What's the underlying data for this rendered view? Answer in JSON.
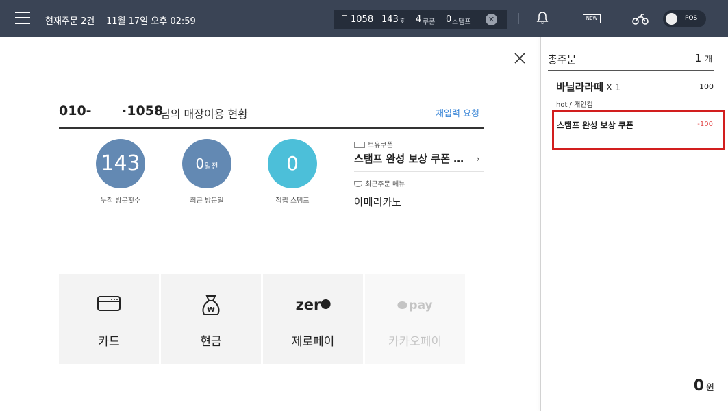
{
  "topbar": {
    "order_status": "현재주문 2건",
    "datetime": "11월 17일 오후 02:59",
    "customer_phone_last4": "1058",
    "visit_count": "143",
    "visit_unit": "회",
    "coupon_count": "4",
    "coupon_unit": "쿠폰",
    "stamp_count": "0",
    "stamp_unit": "스탬프",
    "new_badge": "NEW",
    "pos_toggle_label": "POS",
    "icons": [
      "menu-icon",
      "phone-icon",
      "close-icon",
      "bell-icon",
      "new-icon",
      "delivery-bike-icon"
    ]
  },
  "customer": {
    "phone_prefix": "010-",
    "phone_suffix": "·1058",
    "title_suffix": "님의 매장이용 현황",
    "reinput_link": "재입력 요청",
    "stats": [
      {
        "value": "143",
        "unit": "",
        "label": "누적 방문횟수",
        "color": "#6389b3"
      },
      {
        "value": "0",
        "unit": "일전",
        "label": "최근 방문일",
        "color": "#6389b3"
      },
      {
        "value": "0",
        "unit": "",
        "label": "적립 스탬프",
        "color": "#4cbfd9"
      }
    ],
    "coupon_header": "보유쿠폰",
    "coupon_name": "스탬프 완성 보상 쿠폰 …",
    "recent_header": "최근주문 메뉴",
    "recent_menu": "아메리카노"
  },
  "payments": [
    {
      "label": "카드",
      "icon": "card-icon",
      "enabled": true
    },
    {
      "label": "현금",
      "icon": "cash-bag-icon",
      "enabled": true
    },
    {
      "label": "제로페이",
      "icon": "zeropay-logo",
      "logo_text": "zer",
      "enabled": true
    },
    {
      "label": "카카오페이",
      "icon": "kakaopay-logo",
      "logo_text": "pay",
      "enabled": false
    }
  ],
  "order": {
    "header": "총주문",
    "count": "1",
    "count_unit": "개",
    "items": [
      {
        "name": "바닐라라떼",
        "qty": "X 1",
        "price": "100",
        "options": "hot / 개인컵"
      }
    ],
    "discount": {
      "name": "스탬프 완성 보상 쿠폰",
      "amount": "-100"
    },
    "total": "0",
    "total_unit": "원"
  },
  "colors": {
    "topbar_bg": "#3a4455",
    "stat_blue": "#6389b3",
    "stat_cyan": "#4cbfd9",
    "link_blue": "#3f89d8",
    "highlight_red": "#d21e1e",
    "discount_red": "#e24a4a"
  }
}
